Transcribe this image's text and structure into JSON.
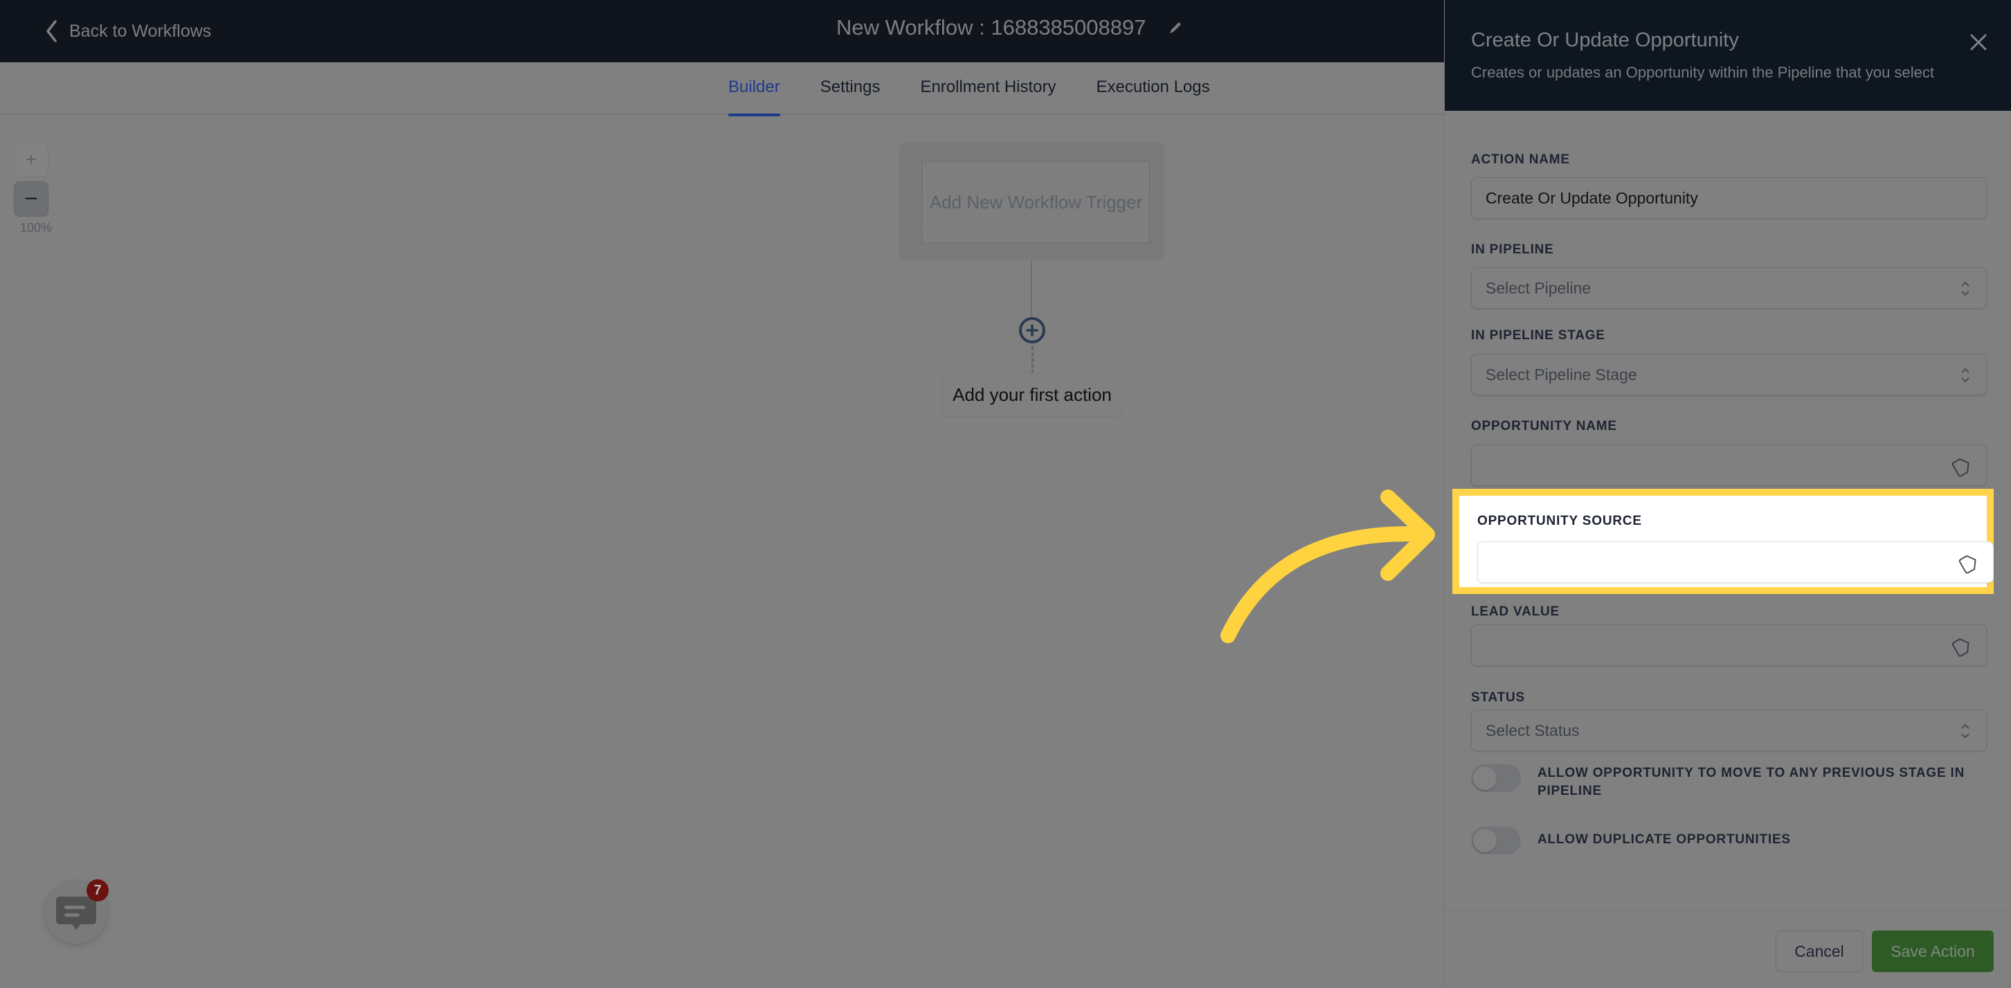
{
  "header": {
    "back_label": "Back to Workflows",
    "workflow_title": "New Workflow : 1688385008897"
  },
  "tabs": [
    {
      "label": "Builder",
      "active": true
    },
    {
      "label": "Settings",
      "active": false
    },
    {
      "label": "Enrollment History",
      "active": false
    },
    {
      "label": "Execution Logs",
      "active": false
    }
  ],
  "zoom": {
    "plus_label": "+",
    "minus_label": "−",
    "level": "100%"
  },
  "canvas": {
    "trigger_label": "Add New Workflow Trigger",
    "first_action_label": "Add your first action"
  },
  "chat_widget": {
    "badge_count": "7"
  },
  "panel": {
    "title": "Create Or Update Opportunity",
    "subtitle": "Creates or updates an Opportunity within the Pipeline that you select",
    "fields": {
      "action_name": {
        "label": "ACTION NAME",
        "value": "Create Or Update Opportunity"
      },
      "in_pipeline": {
        "label": "IN PIPELINE",
        "placeholder": "Select Pipeline"
      },
      "in_pipeline_stage": {
        "label": "IN PIPELINE STAGE",
        "placeholder": "Select Pipeline Stage"
      },
      "opportunity_name": {
        "label": "OPPORTUNITY NAME",
        "value": ""
      },
      "opportunity_source": {
        "label": "OPPORTUNITY SOURCE",
        "value": ""
      },
      "lead_value": {
        "label": "LEAD VALUE",
        "value": ""
      },
      "status": {
        "label": "STATUS",
        "placeholder": "Select Status"
      }
    },
    "toggles": [
      {
        "label": "ALLOW OPPORTUNITY TO MOVE TO ANY PREVIOUS STAGE IN PIPELINE",
        "on": false
      },
      {
        "label": "ALLOW DUPLICATE OPPORTUNITIES",
        "on": false
      }
    ],
    "cancel_label": "Cancel",
    "save_label": "Save Action"
  },
  "colors": {
    "header_bg": "#10151d",
    "active_tab": "#1e3a8a",
    "highlight": "#ffd34a",
    "save_button": "#2d5a25",
    "badge": "#6b1310"
  }
}
